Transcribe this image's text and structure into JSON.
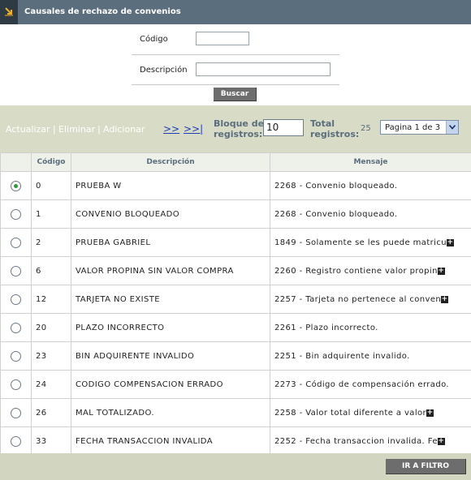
{
  "header": {
    "title": "Causales de rechazo de convenios",
    "icon": "arrow-down-right-icon"
  },
  "form": {
    "codigo_label": "Código",
    "codigo_value": "",
    "descripcion_label": "Descripción",
    "descripcion_value": "",
    "search_label": "Buscar"
  },
  "toolbar": {
    "actualizar": "Actualizar",
    "eliminar": "Eliminar",
    "adicionar": "Adicionar",
    "separator": "|",
    "next": ">>",
    "last": ">>|",
    "bloque_label_1": "Bloque de",
    "bloque_label_2": "registros:",
    "bloque_value": "10",
    "total_label_1": "Total",
    "total_label_2": "registros:",
    "total_value": "25",
    "page_selected": "Pagina 1 de 3"
  },
  "table": {
    "headers": [
      "Código",
      "Descripción",
      "Mensaje"
    ],
    "rows": [
      {
        "selected": true,
        "codigo": "0",
        "descripcion": "PRUEBA W",
        "mensaje": "2268 - Convenio bloqueado.",
        "expandable": false
      },
      {
        "selected": false,
        "codigo": "1",
        "descripcion": "CONVENIO BLOQUEADO",
        "mensaje": "2268 - Convenio bloqueado.",
        "expandable": false
      },
      {
        "selected": false,
        "codigo": "2",
        "descripcion": "PRUEBA GABRIEL",
        "mensaje": "1849 - Solamente se les puede matricu",
        "expandable": true
      },
      {
        "selected": false,
        "codigo": "6",
        "descripcion": "VALOR PROPINA SIN VALOR COMPRA",
        "mensaje": "2260 - Registro contiene valor propin",
        "expandable": true
      },
      {
        "selected": false,
        "codigo": "12",
        "descripcion": "TARJETA NO EXISTE",
        "mensaje": "2257 - Tarjeta no pertenece al conven",
        "expandable": true
      },
      {
        "selected": false,
        "codigo": "20",
        "descripcion": "PLAZO INCORRECTO",
        "mensaje": "2261 - Plazo incorrecto.",
        "expandable": false
      },
      {
        "selected": false,
        "codigo": "23",
        "descripcion": "BIN ADQUIRENTE INVALIDO",
        "mensaje": "2251 - Bin adquirente invalido.",
        "expandable": false
      },
      {
        "selected": false,
        "codigo": "24",
        "descripcion": "CODIGO COMPENSACION ERRADO",
        "mensaje": "2273 - Código de compensación errado.",
        "expandable": false
      },
      {
        "selected": false,
        "codigo": "26",
        "descripcion": "MAL TOTALIZADO.",
        "mensaje": "2258 - Valor total diferente a valor",
        "expandable": true
      },
      {
        "selected": false,
        "codigo": "33",
        "descripcion": "FECHA TRANSACCION INVALIDA",
        "mensaje": "2252 - Fecha transaccion invalida. Fe",
        "expandable": true
      }
    ]
  },
  "footer": {
    "filter_button": "IR A FILTRO"
  },
  "colors": {
    "header_bg": "#5b6e7e",
    "toolbar_bg": "#d8dcc6",
    "link_blue": "#1f3bb8",
    "radio_selected": "#2f9a3a"
  }
}
